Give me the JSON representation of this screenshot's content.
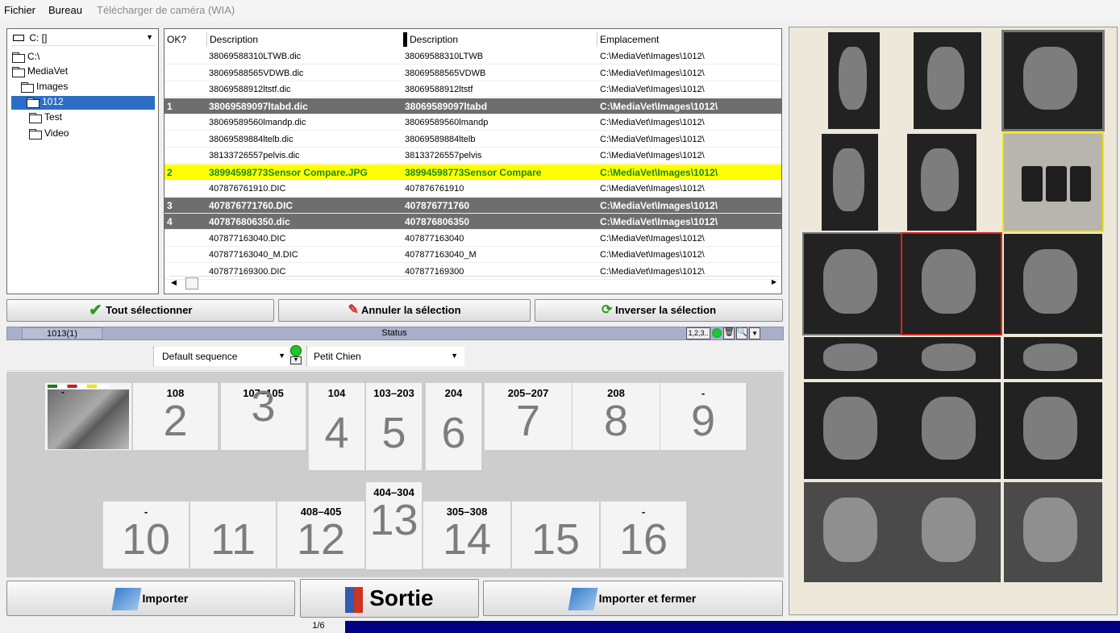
{
  "menu": {
    "file": "Fichier",
    "desk": "Bureau",
    "camera": "Télécharger de caméra (WIA)"
  },
  "tree": {
    "drive": "C: []",
    "items": [
      {
        "label": "C:\\"
      },
      {
        "label": "MediaVet"
      },
      {
        "label": "Images"
      },
      {
        "label": "1012"
      },
      {
        "label": "Test"
      },
      {
        "label": "Video"
      }
    ]
  },
  "files": {
    "headers": [
      "OK?",
      "Description",
      "Description",
      "Emplacement"
    ],
    "rows": [
      {
        "ok": "",
        "desc": "38069588310LTWB.dic",
        "name": "38069588310LTWB",
        "loc": "C:\\MediaVet\\Images\\1012\\",
        "style": "normal"
      },
      {
        "ok": "",
        "desc": "38069588565VDWB.dic",
        "name": "38069588565VDWB",
        "loc": "C:\\MediaVet\\Images\\1012\\",
        "style": "normal"
      },
      {
        "ok": "",
        "desc": "38069588912ltstf.dic",
        "name": "38069588912ltstf",
        "loc": "C:\\MediaVet\\Images\\1012\\",
        "style": "normal"
      },
      {
        "ok": "1",
        "desc": "38069589097ltabd.dic",
        "name": "38069589097ltabd",
        "loc": "C:\\MediaVet\\Images\\1012\\",
        "style": "dark"
      },
      {
        "ok": "",
        "desc": "38069589560lmandp.dic",
        "name": "38069589560lmandp",
        "loc": "C:\\MediaVet\\Images\\1012\\",
        "style": "normal"
      },
      {
        "ok": "",
        "desc": "38069589884ltelb.dic",
        "name": "38069589884ltelb",
        "loc": "C:\\MediaVet\\Images\\1012\\",
        "style": "normal"
      },
      {
        "ok": "",
        "desc": "38133726557pelvis.dic",
        "name": "38133726557pelvis",
        "loc": "C:\\MediaVet\\Images\\1012\\",
        "style": "normal"
      },
      {
        "ok": "2",
        "desc": "38994598773Sensor Compare.JPG",
        "name": "38994598773Sensor Compare",
        "loc": "C:\\MediaVet\\Images\\1012\\",
        "style": "yel"
      },
      {
        "ok": "",
        "desc": "407876761910.DIC",
        "name": "407876761910",
        "loc": "C:\\MediaVet\\Images\\1012\\",
        "style": "normal"
      },
      {
        "ok": "3",
        "desc": "407876771760.DIC",
        "name": "407876771760",
        "loc": "C:\\MediaVet\\Images\\1012\\",
        "style": "dark"
      },
      {
        "ok": "4",
        "desc": "407876806350.dic",
        "name": "407876806350",
        "loc": "C:\\MediaVet\\Images\\1012\\",
        "style": "dark"
      },
      {
        "ok": "",
        "desc": "407877163040.DIC",
        "name": "407877163040",
        "loc": "C:\\MediaVet\\Images\\1012\\",
        "style": "normal"
      },
      {
        "ok": "",
        "desc": "407877163040_M.DIC",
        "name": "407877163040_M",
        "loc": "C:\\MediaVet\\Images\\1012\\",
        "style": "normal"
      },
      {
        "ok": "",
        "desc": "407877169300.DIC",
        "name": "407877169300",
        "loc": "C:\\MediaVet\\Images\\1012\\",
        "style": "normal"
      }
    ]
  },
  "actions": {
    "select_all": "Tout sélectionner",
    "cancel": "Annuler la sélection",
    "invert": "Inverser la sélection"
  },
  "status": {
    "id": "1013(1)",
    "title": "Status",
    "seq_btn": "1,2,3.."
  },
  "selectors": {
    "sequence": "Default sequence",
    "species": "Petit Chien"
  },
  "cards": [
    {
      "label": "108",
      "num": "2"
    },
    {
      "label": "107–105",
      "num": "3"
    },
    {
      "label": "104",
      "num": "4"
    },
    {
      "label": "103–203",
      "num": "5"
    },
    {
      "label": "204",
      "num": "6"
    },
    {
      "label": "205–207",
      "num": "7"
    },
    {
      "label": "208",
      "num": "8"
    },
    {
      "label": "-",
      "num": "9"
    },
    {
      "label": "-",
      "num": "10"
    },
    {
      "label": "",
      "num": "11"
    },
    {
      "label": "408–405",
      "num": "12"
    },
    {
      "label": "404–304",
      "num": "13"
    },
    {
      "label": "305–308",
      "num": "14"
    },
    {
      "label": "",
      "num": "15"
    },
    {
      "label": "-",
      "num": "16"
    }
  ],
  "first_card_label": "-",
  "bottom": {
    "import": "Importer",
    "exit": "Sortie",
    "import_close": "Importer et fermer"
  },
  "pager": "1/6",
  "colors": {
    "selected_blue": "#2c6ec6",
    "yellow_row": "#ffff00",
    "dark_row": "#6e6e6e",
    "progress": "#000080"
  }
}
